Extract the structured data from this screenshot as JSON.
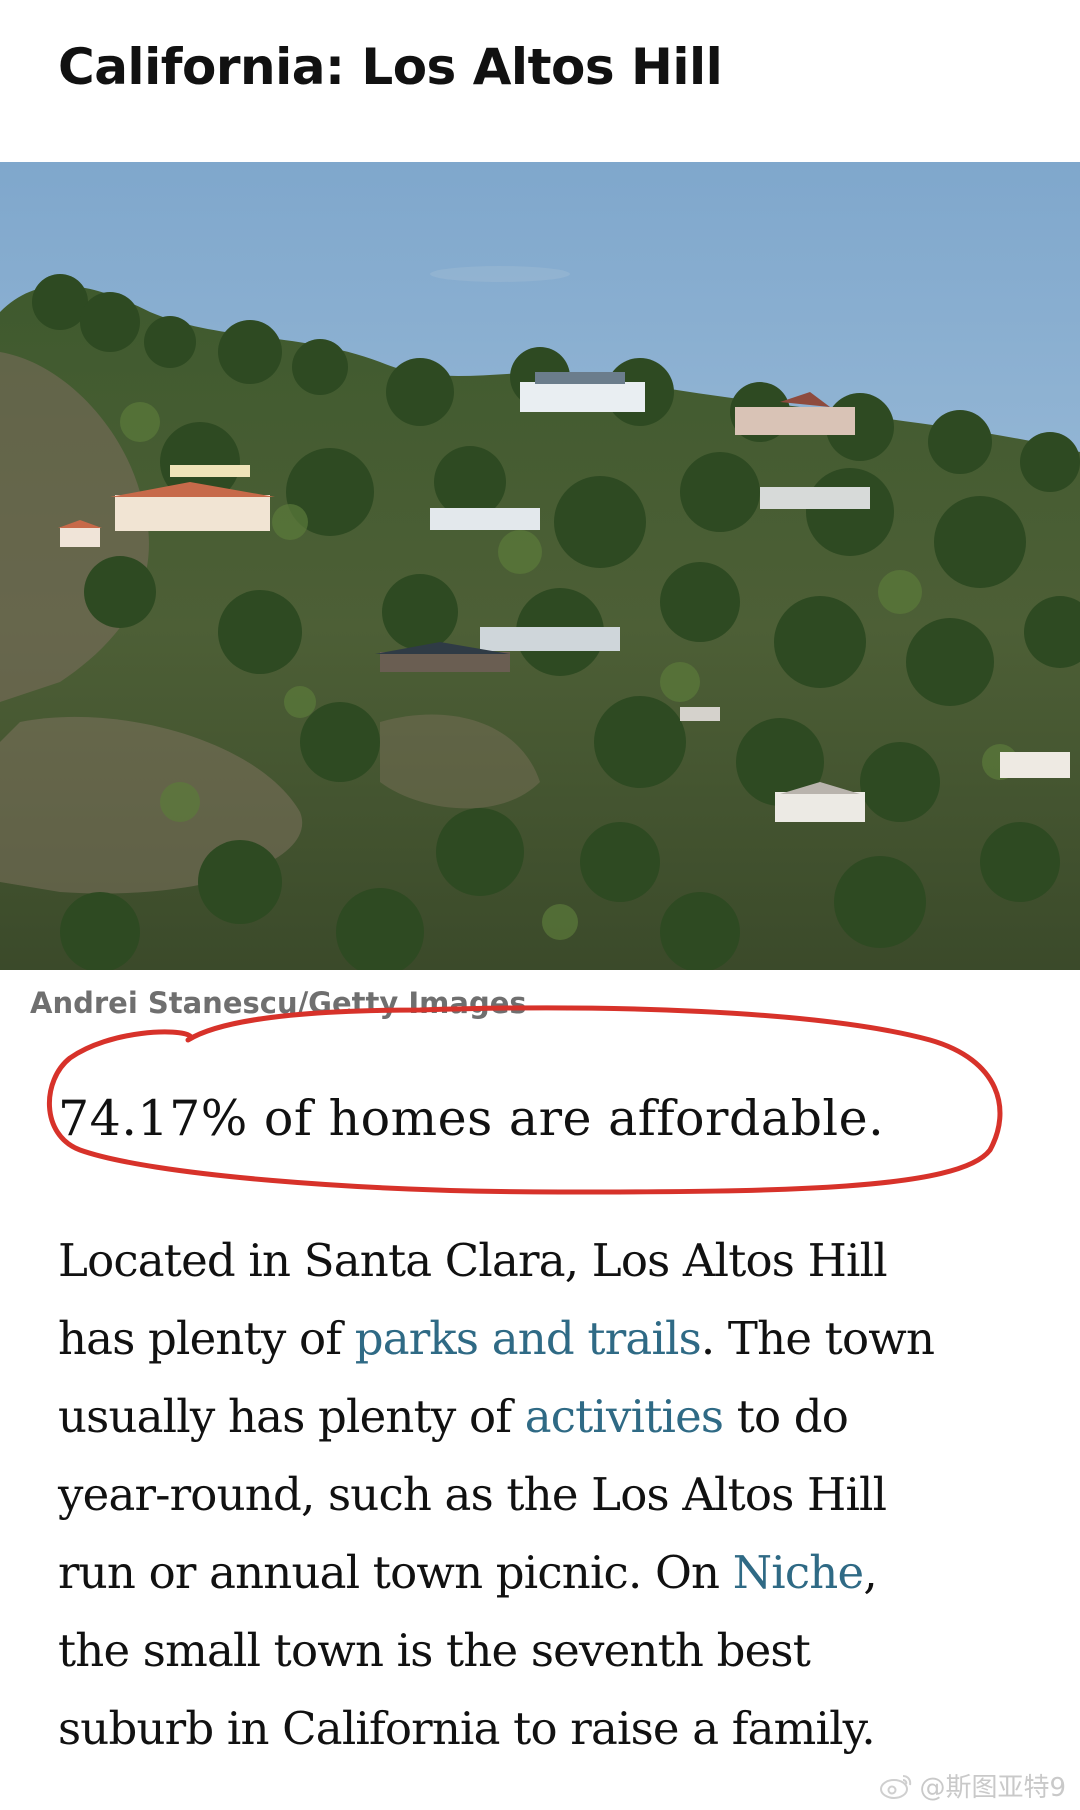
{
  "article": {
    "headline": "California: Los Altos Hill",
    "image_alt": "Hillside homes among trees",
    "photo_credit": "Andrei Stanescu/Getty Images",
    "stat_line": "74.17% of homes are affordable.",
    "body": {
      "line1": "Located in Santa Clara, Los Altos Hill",
      "line2_before": "has plenty of ",
      "line2_link": "parks and trails",
      "line2_after": ". The town",
      "line3_before": "usually has plenty of ",
      "line3_link": "activities",
      "line3_after": " to do",
      "line4": "year-round, such as the Los Altos Hill",
      "line5_before": "run or annual town picnic. On ",
      "line5_link": "Niche",
      "line5_after": ",",
      "line6": "the small town is the seventh best",
      "line7": "suburb in California to raise a family."
    }
  },
  "annotation": {
    "color": "#d7322a",
    "icon": "hand-drawn-circle"
  },
  "watermark": {
    "text": "@斯图亚特9",
    "icon": "weibo-icon"
  },
  "colors": {
    "link": "#2f6a85",
    "credit": "#6f6f6f",
    "sky": "#8fb4d4"
  }
}
